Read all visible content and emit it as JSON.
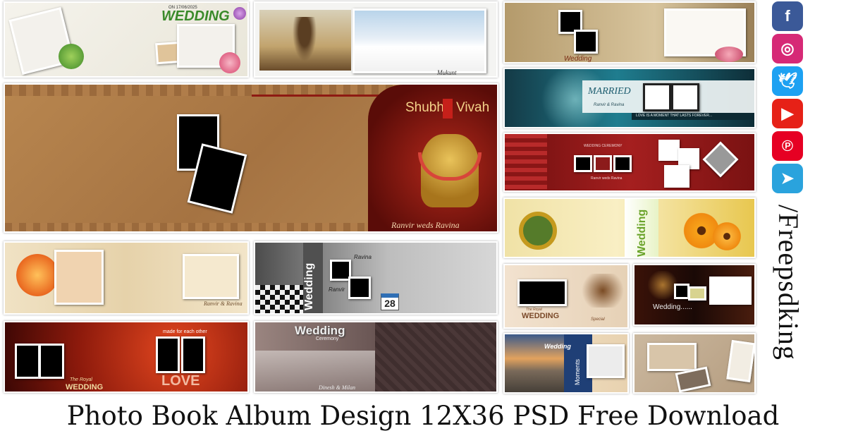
{
  "caption": "Photo Book Album Design 12X36 PSD Free Download",
  "brand": "/Freepsdking",
  "social_icons": [
    {
      "name": "facebook-icon",
      "glyph": "f",
      "color": "#3b5998"
    },
    {
      "name": "instagram-icon",
      "glyph": "◎",
      "color": "#d62976"
    },
    {
      "name": "twitter-icon",
      "glyph": "🕊",
      "color": "#1da1f2"
    },
    {
      "name": "youtube-icon",
      "glyph": "▶",
      "color": "#e62117"
    },
    {
      "name": "pinterest-icon",
      "glyph": "℗",
      "color": "#e60023"
    },
    {
      "name": "telegram-icon",
      "glyph": "➤",
      "color": "#2aa3dd"
    }
  ],
  "tiles": {
    "t1": {
      "title": "WEDDING",
      "date": "ON 17/06/2025"
    },
    "t2": {
      "signature": "Mukunt"
    },
    "t3": {
      "title_left": "Shubh",
      "title_right": "Vivah",
      "footer": "Ranvir weds Ravina"
    },
    "t4": {
      "subtitle": "Ranvir & Ravina"
    },
    "t5": {
      "title": "Wedding",
      "name1": "Ravina",
      "name2": "Ranvir",
      "calendar_day": "28"
    },
    "t6": {
      "tagline": "made for each other",
      "title": "WEDDING",
      "title_small": "The Royal",
      "love": "LOVE"
    },
    "t7": {
      "title": "Wedding",
      "subtitle": "Ceremony",
      "footer": "Dinesh & Milan"
    },
    "t8": {
      "title": "Wedding"
    },
    "t9": {
      "title": "MARRIED",
      "subtitle": "Ranvir & Ravina",
      "quote": "LOVE IS A MOMENT THAT LASTS FOREVER..."
    },
    "t10": {
      "title": "WEDDING CEREMONY",
      "footer": "Ranvir weds Ravina"
    },
    "t11": {
      "title": "Wedding"
    },
    "t12": {
      "title": "WEDDING",
      "title_small": "The Royal",
      "footer": "Special"
    },
    "t13": {
      "title": "Wedding......"
    },
    "t14": {
      "title": "Wedding",
      "subtitle": "Moments"
    }
  }
}
